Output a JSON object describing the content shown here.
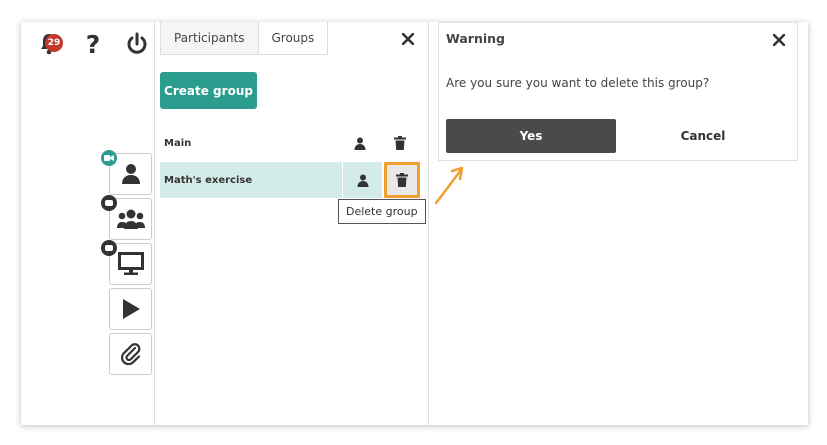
{
  "header": {
    "notifications_count": "29"
  },
  "tabs": [
    {
      "label": "Participants"
    },
    {
      "label": "Groups"
    }
  ],
  "groups_panel": {
    "create_label": "Create group",
    "rows": [
      {
        "name": "Main"
      },
      {
        "name": "Math's exercise"
      }
    ],
    "tooltip": "Delete group"
  },
  "dialog": {
    "title": "Warning",
    "message": "Are you sure you want to delete this group?",
    "yes_label": "Yes",
    "cancel_label": "Cancel"
  },
  "colors": {
    "accent": "#2a9d8f",
    "badge": "#c0392b",
    "highlight": "#f0a030",
    "selected_row": "#d4ece8",
    "primary_button": "#4a4a4a"
  },
  "icons": [
    "bell-icon",
    "help-icon",
    "power-icon",
    "user-icon",
    "users-icon",
    "monitor-icon",
    "play-icon",
    "paperclip-icon",
    "trash-icon",
    "close-icon",
    "camera-icon",
    "arrow-icon"
  ]
}
